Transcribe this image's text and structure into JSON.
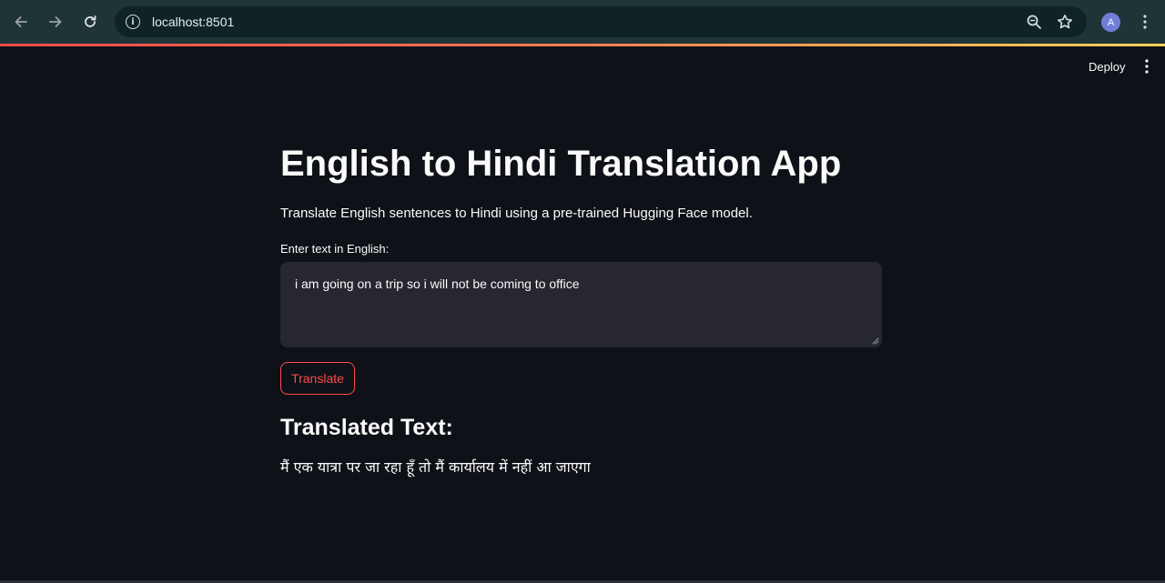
{
  "browser": {
    "url": "localhost:8501",
    "profile_initial": "A",
    "icons": {
      "back": "arrow-left-icon",
      "forward": "arrow-right-icon",
      "reload": "reload-icon",
      "site_info": "info-icon",
      "zoom": "zoom-icon",
      "bookmark": "star-icon",
      "menu": "kebab-menu-icon"
    }
  },
  "app_header": {
    "deploy_label": "Deploy",
    "menu_icon": "kebab-menu-icon"
  },
  "main": {
    "title": "English to Hindi Translation App",
    "subtitle": "Translate English sentences to Hindi using a pre-trained Hugging Face model.",
    "input_label": "Enter text in English:",
    "input_value": "i am going on a trip so i will not be coming to office",
    "translate_label": "Translate",
    "result_heading": "Translated Text:",
    "result_text": "मैं एक यात्रा पर जा रहा हूँ तो मैं कार्यालय में नहीं आ जाएगा"
  },
  "colors": {
    "background": "#0e1117",
    "browser_bar": "#1f3437",
    "text_area": "#262730",
    "accent": "#ff4b4b",
    "text": "#fafafa"
  }
}
